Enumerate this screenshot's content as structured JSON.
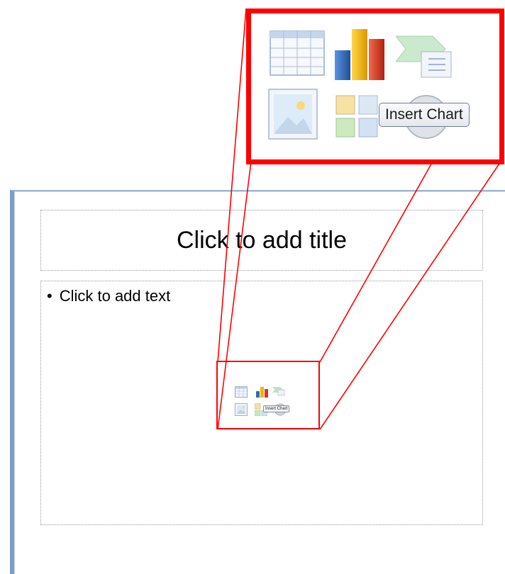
{
  "slide": {
    "title_placeholder": "Click to add title",
    "body_placeholder": "Click to add text",
    "bullet": "•"
  },
  "content_icons": [
    {
      "name": "table-icon",
      "tooltip": ""
    },
    {
      "name": "chart-icon",
      "tooltip": "Insert Chart"
    },
    {
      "name": "smartart-icon",
      "tooltip": ""
    },
    {
      "name": "picture-icon",
      "tooltip": ""
    },
    {
      "name": "clipart-icon",
      "tooltip": ""
    },
    {
      "name": "media-icon",
      "tooltip": ""
    }
  ],
  "tooltip": {
    "label": "Insert Chart"
  },
  "colors": {
    "callout_border": "#ff0000",
    "slide_border": "#7d9ccc"
  }
}
